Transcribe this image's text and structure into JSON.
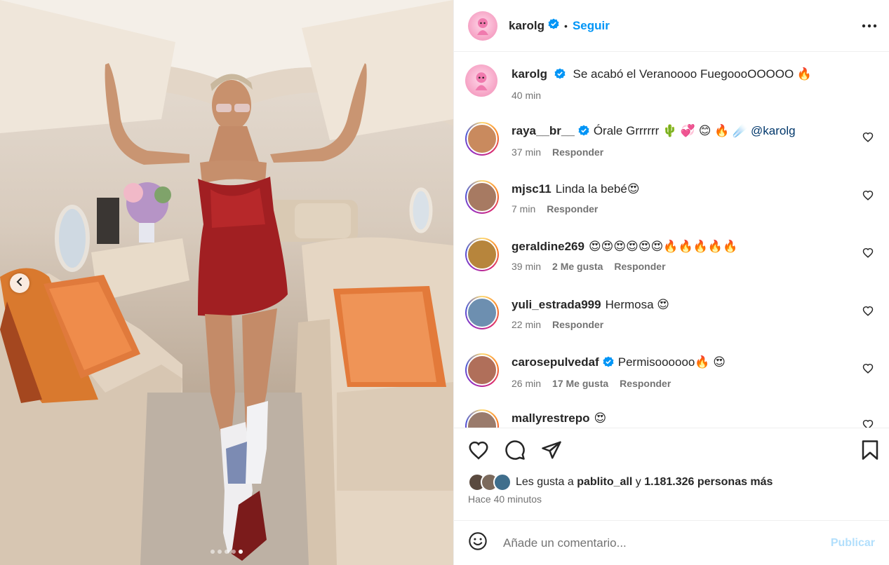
{
  "post": {
    "owner": {
      "username": "karolg",
      "verified": true,
      "separator": "•",
      "follow_label": "Seguir",
      "avatar_color": "#f7a9c9"
    },
    "more_icon": "more-horizontal-icon",
    "photo": {
      "nav_prev_icon": "chevron-left-icon",
      "pages_total": 5,
      "page_current": 5
    },
    "caption": {
      "username": "karolg",
      "text": "Se acabó el Veranoooo FuegoooOOOOO 🔥",
      "time": "40 min"
    },
    "comments": [
      {
        "username": "raya__br__",
        "verified": true,
        "text": "Órale Grrrrrr 🌵 💞 😊 🔥 ☄️",
        "mention": "@karolg",
        "time": "37 min",
        "likes_label": "",
        "reply_label": "Responder",
        "avatar_color": "#c98a5e"
      },
      {
        "username": "mjsc11",
        "verified": false,
        "text": "Linda la bebé😍",
        "mention": "",
        "time": "7 min",
        "likes_label": "",
        "reply_label": "Responder",
        "avatar_color": "#a77a62"
      },
      {
        "username": "geraldine269",
        "verified": false,
        "text": "😍😍😍😍😍😍🔥🔥🔥🔥🔥",
        "mention": "",
        "time": "39 min",
        "likes_label": "2 Me gusta",
        "reply_label": "Responder",
        "avatar_color": "#b7853c"
      },
      {
        "username": "yuli_estrada999",
        "verified": false,
        "text": "Hermosa 😍",
        "mention": "",
        "time": "22 min",
        "likes_label": "",
        "reply_label": "Responder",
        "avatar_color": "#6d8fb0"
      },
      {
        "username": "carosepulvedaf",
        "verified": true,
        "text": "Permisoooooo🔥 😍",
        "mention": "",
        "time": "26 min",
        "likes_label": "17 Me gusta",
        "reply_label": "Responder",
        "avatar_color": "#b06f5a"
      },
      {
        "username": "mallyrestrepo",
        "verified": false,
        "text": "😍",
        "mention": "",
        "time": "",
        "likes_label": "",
        "reply_label": "",
        "avatar_color": "#9a7b6c"
      }
    ],
    "actions": {
      "like_icon": "heart-icon",
      "comment_icon": "comment-icon",
      "share_icon": "share-icon",
      "save_icon": "bookmark-icon"
    },
    "likes": {
      "prefix": "Les gusta a",
      "user": "pablito_all",
      "joiner": "y",
      "count_text": "1.181.326 personas más"
    },
    "posted_ago": "Hace 40 minutos",
    "add_comment": {
      "emoji_icon": "smiley-icon",
      "placeholder": "Añade un comentario...",
      "publish_label": "Publicar"
    },
    "colors": {
      "accent": "#0095f6",
      "verified_badge": "#0095f6",
      "publish_disabled": "#b2dffc",
      "secondary_text": "#737373"
    }
  }
}
